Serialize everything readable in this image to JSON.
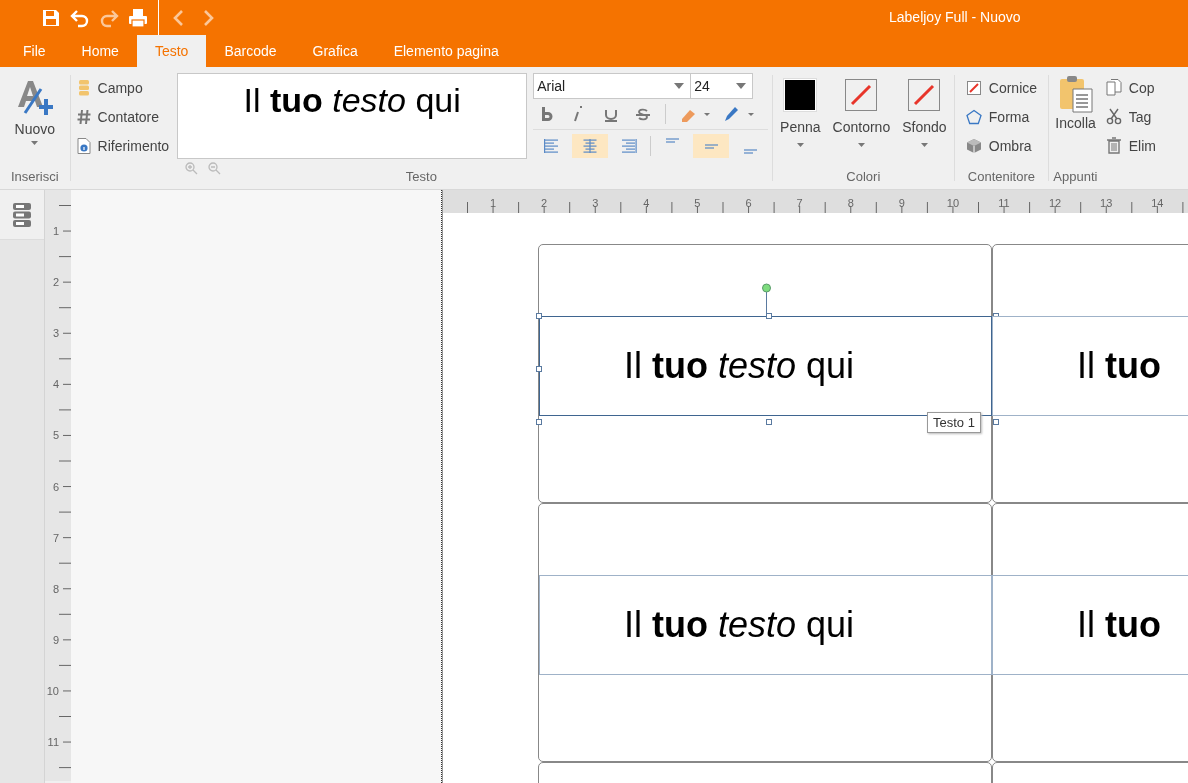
{
  "window": {
    "title": "Labeljoy Full - Nuovo"
  },
  "quick_access": [
    {
      "kind": "save",
      "disabled": false
    },
    {
      "kind": "undo",
      "disabled": false
    },
    {
      "kind": "redo",
      "disabled": true
    },
    {
      "kind": "print",
      "disabled": false
    },
    {
      "kind": "back",
      "disabled": true
    },
    {
      "kind": "forward",
      "disabled": true
    }
  ],
  "tabs": [
    {
      "label": "File",
      "selected": false
    },
    {
      "label": "Home",
      "selected": false
    },
    {
      "label": "Testo",
      "selected": true
    },
    {
      "label": "Barcode",
      "selected": false
    },
    {
      "label": "Grafica",
      "selected": false
    },
    {
      "label": "Elemento pagina",
      "selected": false
    }
  ],
  "ribbon": {
    "insert": {
      "button": "Nuovo",
      "label": "Inserisci"
    },
    "text": {
      "label": "Testo",
      "items": [
        {
          "kind": "field",
          "label": "Campo"
        },
        {
          "kind": "counter",
          "label": "Contatore"
        },
        {
          "kind": "reference",
          "label": "Riferimento"
        }
      ],
      "preview": "Il **tuo** *testo* qui",
      "font": "Arial",
      "size": "24",
      "styles": [
        {
          "kind": "bold"
        },
        {
          "kind": "italic"
        },
        {
          "kind": "underline"
        },
        {
          "kind": "strike"
        },
        {
          "kind": "highlight"
        },
        {
          "kind": "pen"
        }
      ],
      "alignment": [
        {
          "kind": "left",
          "selected": false
        },
        {
          "kind": "center",
          "selected": true
        },
        {
          "kind": "right",
          "selected": false
        }
      ],
      "vertical": [
        {
          "kind": "top",
          "selected": false
        },
        {
          "kind": "middle",
          "selected": true
        },
        {
          "kind": "bottom",
          "selected": false
        }
      ]
    },
    "colors": {
      "label": "Colori",
      "items": [
        {
          "label": "Penna",
          "kind": "solid",
          "color": "#000000"
        },
        {
          "label": "Contorno",
          "kind": "none"
        },
        {
          "label": "Sfondo",
          "kind": "none"
        }
      ]
    },
    "container": {
      "label": "Contenitore",
      "items": [
        {
          "kind": "frame",
          "label": "Cornice"
        },
        {
          "kind": "shape",
          "label": "Forma"
        },
        {
          "kind": "shadow",
          "label": "Ombra"
        }
      ]
    },
    "clipboard": {
      "label": "Appunti",
      "paste": "Incolla",
      "items": [
        {
          "kind": "copy",
          "label": "Cop"
        },
        {
          "kind": "cut",
          "label": "Tag"
        },
        {
          "kind": "delete",
          "label": "Elim"
        }
      ]
    }
  },
  "rulers": {
    "horizontal": [
      "1",
      "2",
      "3",
      "4",
      "5",
      "6",
      "7",
      "8",
      "9",
      "10",
      "11",
      "12",
      "13",
      "14"
    ],
    "vertical": [
      "1",
      "2",
      "3",
      "4",
      "5",
      "6",
      "7",
      "8",
      "9",
      "10",
      "11"
    ]
  },
  "labels": [
    {
      "text": "Il **tuo** *testo* qui",
      "selected": true,
      "tooltip": "Testo 1"
    },
    {
      "text": "Il **tuo**",
      "selected": false
    },
    {
      "text": "Il **tuo** *testo* qui",
      "selected": false
    },
    {
      "text": "Il **tuo**",
      "selected": false
    }
  ]
}
